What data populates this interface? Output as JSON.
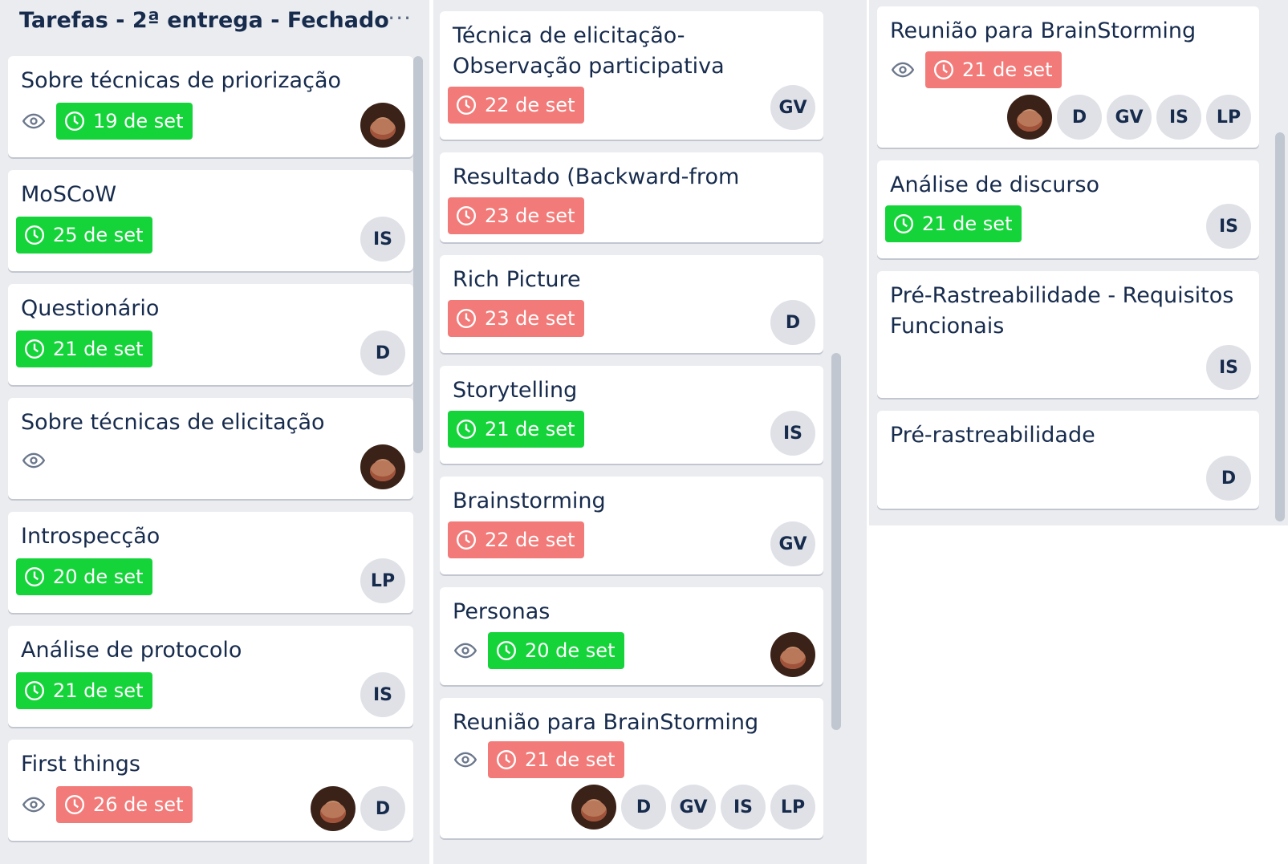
{
  "lists": [
    {
      "title": "Tarefas - 2ª entrega - Fechado",
      "menu": "···",
      "cards": [
        {
          "title": "Sobre técnicas de priorização",
          "watch": true,
          "due": {
            "label": "19 de set",
            "status": "complete",
            "color": "#15d43a"
          },
          "members": [
            "avatar"
          ]
        },
        {
          "title": "MoSCoW",
          "watch": false,
          "due": {
            "label": "25 de set",
            "status": "complete",
            "color": "#15d43a"
          },
          "members": [
            "IS"
          ]
        },
        {
          "title": "Questionário",
          "watch": false,
          "due": {
            "label": "21 de set",
            "status": "complete",
            "color": "#15d43a"
          },
          "members": [
            "D"
          ]
        },
        {
          "title": "Sobre técnicas de elicitação",
          "watch": true,
          "due": null,
          "members": [
            "avatar"
          ]
        },
        {
          "title": "Introspecção",
          "watch": false,
          "due": {
            "label": "20 de set",
            "status": "complete",
            "color": "#15d43a"
          },
          "members": [
            "LP"
          ]
        },
        {
          "title": "Análise de protocolo",
          "watch": false,
          "due": {
            "label": "21 de set",
            "status": "complete",
            "color": "#15d43a"
          },
          "members": [
            "IS"
          ]
        },
        {
          "title": "First things",
          "watch": true,
          "due": {
            "label": "26 de set",
            "status": "overdue",
            "color": "#f27b79"
          },
          "members": [
            "avatar",
            "D"
          ]
        }
      ]
    },
    {
      "title": "",
      "cards": [
        {
          "title": "Técnica de elicitação- Observação participativa",
          "watch": false,
          "due": {
            "label": "22 de set",
            "status": "overdue",
            "color": "#f27b79"
          },
          "members": [
            "GV"
          ]
        },
        {
          "title": "Resultado (Backward-from Geral)",
          "watch": false,
          "due": {
            "label": "23 de set",
            "status": "overdue",
            "color": "#f27b79"
          },
          "members": []
        },
        {
          "title": "Rich Picture",
          "watch": false,
          "due": {
            "label": "23 de set",
            "status": "overdue",
            "color": "#f27b79"
          },
          "members": [
            "D"
          ]
        },
        {
          "title": "Storytelling",
          "watch": false,
          "due": {
            "label": "21 de set",
            "status": "complete",
            "color": "#15d43a"
          },
          "members": [
            "IS"
          ]
        },
        {
          "title": "Brainstorming",
          "watch": false,
          "due": {
            "label": "22 de set",
            "status": "overdue",
            "color": "#f27b79"
          },
          "members": [
            "GV"
          ]
        },
        {
          "title": "Personas",
          "watch": true,
          "due": {
            "label": "20 de set",
            "status": "complete",
            "color": "#15d43a"
          },
          "members": [
            "avatar"
          ]
        },
        {
          "title": "Reunião para BrainStorming",
          "watch": true,
          "due": {
            "label": "21 de set",
            "status": "overdue",
            "color": "#f27b79"
          },
          "members": [
            "avatar",
            "D",
            "GV",
            "IS",
            "LP"
          ]
        }
      ]
    },
    {
      "title": "",
      "cards": [
        {
          "title": "Reunião para BrainStorming",
          "watch": true,
          "due": {
            "label": "21 de set",
            "status": "overdue",
            "color": "#f27b79"
          },
          "members": [
            "avatar",
            "D",
            "GV",
            "IS",
            "LP"
          ]
        },
        {
          "title": "Análise de discurso",
          "watch": false,
          "due": {
            "label": "21 de set",
            "status": "complete",
            "color": "#15d43a"
          },
          "members": [
            "IS"
          ]
        },
        {
          "title": "Pré-Rastreabilidade - Requisitos Funcionais",
          "watch": false,
          "due": null,
          "members": [
            "IS"
          ]
        },
        {
          "title": "Pré-rastreabilidade",
          "watch": false,
          "due": null,
          "members": [
            "D"
          ]
        }
      ]
    }
  ]
}
